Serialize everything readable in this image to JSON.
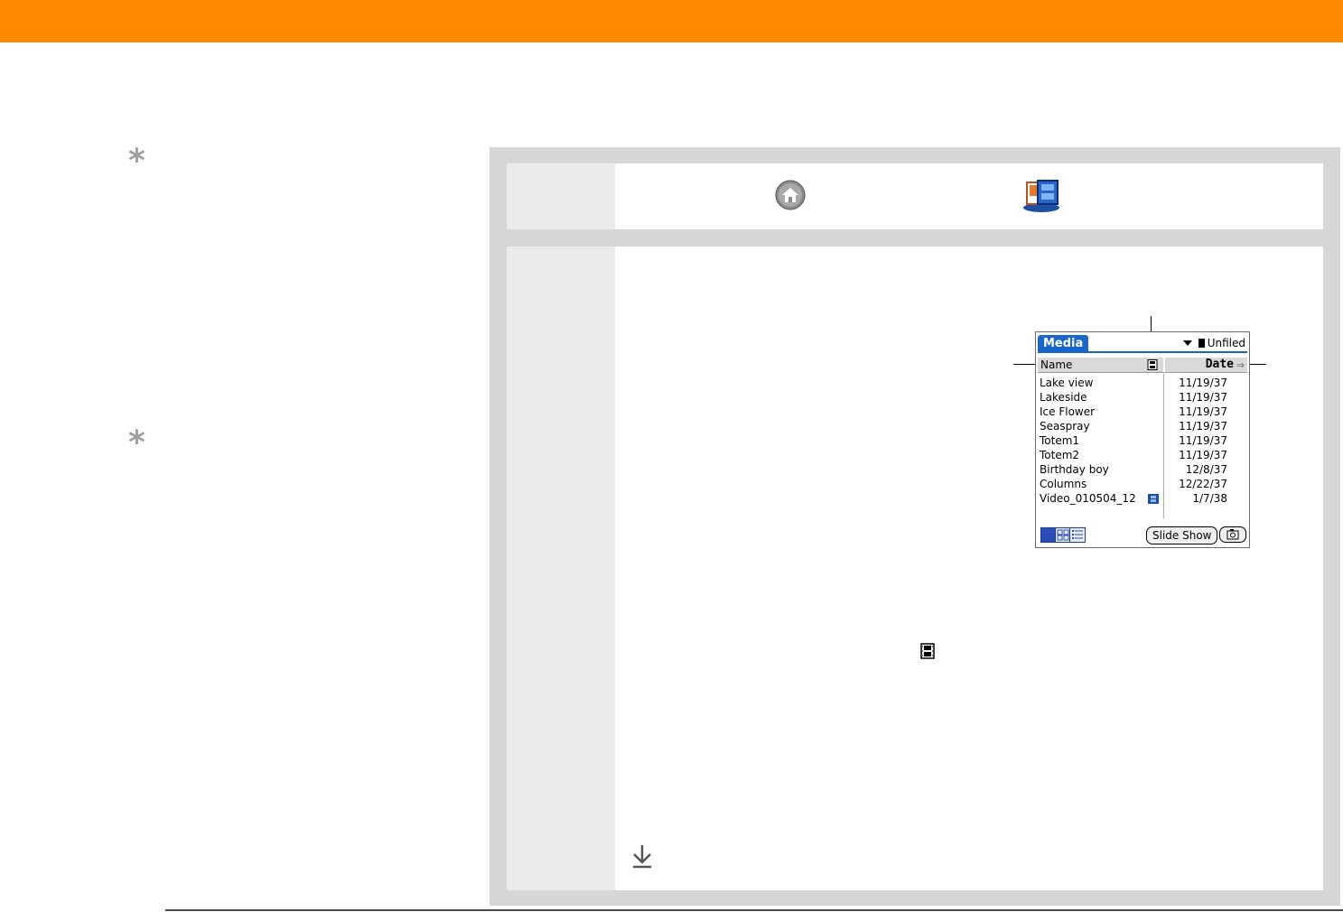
{
  "header": {
    "bar_color": "#ff8a00"
  },
  "sidebar": {
    "tips": [
      {
        "icon": "asterisk-icon"
      },
      {
        "icon": "asterisk-icon"
      }
    ]
  },
  "steps": [
    {
      "icons": [
        "home-icon",
        "media-app-icon"
      ]
    },
    {
      "icons": [
        "film-icon",
        "continue-arrow-icon"
      ]
    }
  ],
  "device": {
    "app_tab": "Media",
    "category": "Unfiled",
    "columns": {
      "name": "Name",
      "date": "Date"
    },
    "items": [
      {
        "name": "Lake view",
        "date": "11/19/37",
        "video": false
      },
      {
        "name": "Lakeside",
        "date": "11/19/37",
        "video": false
      },
      {
        "name": "Ice Flower",
        "date": "11/19/37",
        "video": false
      },
      {
        "name": "Seaspray",
        "date": "11/19/37",
        "video": false
      },
      {
        "name": "Totem1",
        "date": "11/19/37",
        "video": false
      },
      {
        "name": "Totem2",
        "date": "11/19/37",
        "video": false
      },
      {
        "name": "Birthday boy",
        "date": "12/8/37",
        "video": false
      },
      {
        "name": "Columns",
        "date": "12/22/37",
        "video": false
      },
      {
        "name": "Video_010504_12",
        "date": "1/7/38",
        "video": true
      }
    ],
    "slide_show_label": "Slide Show",
    "accent_color": "#1866c8"
  }
}
